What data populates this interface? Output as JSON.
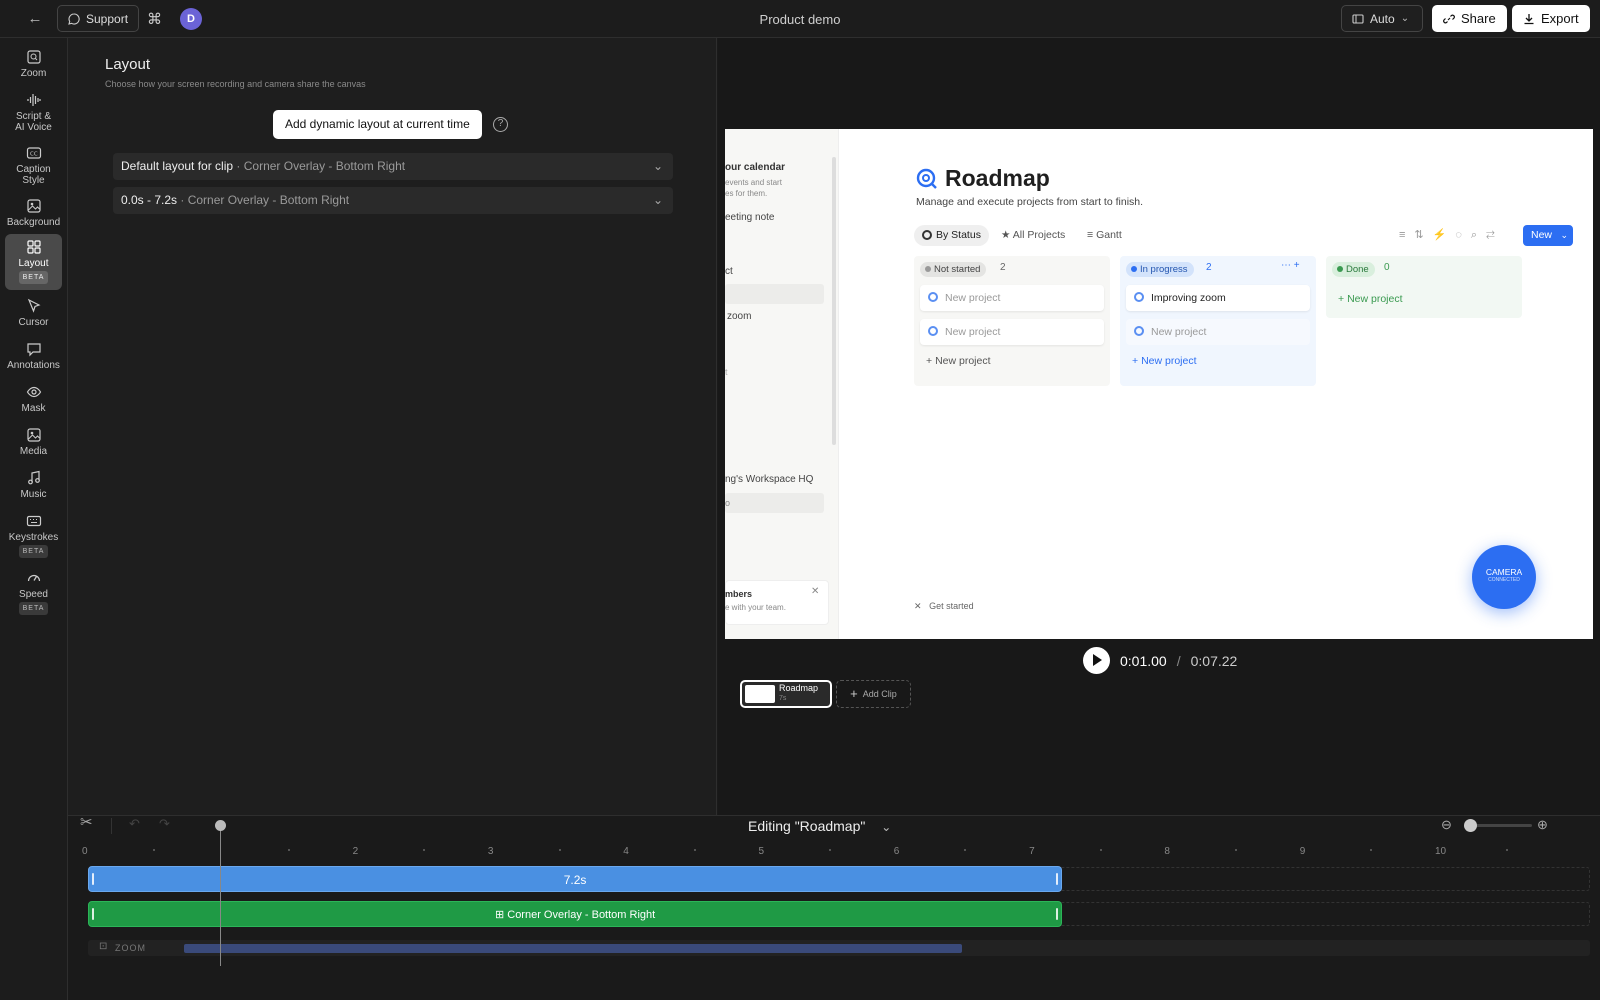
{
  "topbar": {
    "support_label": "Support",
    "avatar_initial": "D",
    "title": "Product demo",
    "auto_label": "Auto",
    "share_label": "Share",
    "export_label": "Export"
  },
  "sidebar": {
    "items": [
      {
        "label": "Zoom",
        "icon": "zoom-icon"
      },
      {
        "label": "Script &",
        "label2": "AI Voice",
        "icon": "waveform-icon"
      },
      {
        "label": "Caption",
        "label2": "Style",
        "icon": "caption-icon"
      },
      {
        "label": "Background",
        "icon": "image-icon"
      },
      {
        "label": "Layout",
        "icon": "grid-icon",
        "badge": "BETA",
        "active": true
      },
      {
        "label": "Cursor",
        "icon": "cursor-icon"
      },
      {
        "label": "Annotations",
        "icon": "comment-icon"
      },
      {
        "label": "Mask",
        "icon": "eye-icon"
      },
      {
        "label": "Media",
        "icon": "media-icon"
      },
      {
        "label": "Music",
        "icon": "music-icon"
      },
      {
        "label": "Keystrokes",
        "icon": "keyboard-icon",
        "badge": "BETA"
      },
      {
        "label": "Speed",
        "icon": "gauge-icon",
        "badge": "BETA"
      }
    ]
  },
  "panel": {
    "title": "Layout",
    "subtitle": "Choose how your screen recording and camera share the canvas",
    "add_button": "Add dynamic layout at current time",
    "rows": [
      {
        "title": "Default layout for clip",
        "detail": " · Corner Overlay - Bottom Right"
      },
      {
        "title": "0.0s - 7.2s",
        "detail": " · Corner Overlay - Bottom Right"
      }
    ]
  },
  "preview": {
    "sidebar_texts": [
      "our calendar",
      "events and start",
      "es for them.",
      "eeting note",
      "ct",
      "zoom",
      "t",
      "ng's Workspace HQ",
      "o",
      "mbers",
      "e with your team."
    ],
    "page_title": "Roadmap",
    "page_subtitle": "Manage and execute projects from start to finish.",
    "tabs": [
      "By Status",
      "All Projects",
      "Gantt"
    ],
    "new_button": "New",
    "columns": [
      {
        "status": "Not started",
        "count": "2",
        "cards": [
          "New project",
          "New project"
        ],
        "add": "New project"
      },
      {
        "status": "In progress",
        "count": "2",
        "cards": [
          "Improving zoom",
          "New project"
        ],
        "add": "New project"
      },
      {
        "status": "Done",
        "count": "0",
        "cards": [],
        "add": "New project"
      }
    ],
    "get_started": "Get started",
    "camera_label": "CAMERA",
    "camera_sub": "CONNECTED",
    "time_current": "0:01.00",
    "time_sep": "/",
    "time_total": "0:07.22",
    "clip_name": "Roadmap",
    "clip_duration": "7s",
    "add_clip": "Add Clip"
  },
  "timeline": {
    "editing_label": "Editing \"Roadmap\"",
    "ruler": [
      "0",
      "2",
      "3",
      "4",
      "5",
      "6",
      "7",
      "8",
      "9",
      "10"
    ],
    "clip_label": "7.2s",
    "layout_label": "Corner Overlay - Bottom Right",
    "zoom_label": "ZOOM",
    "playhead_seconds": 1.0,
    "clip_seconds": 7.2,
    "zoom_slider_level": 0.0
  }
}
